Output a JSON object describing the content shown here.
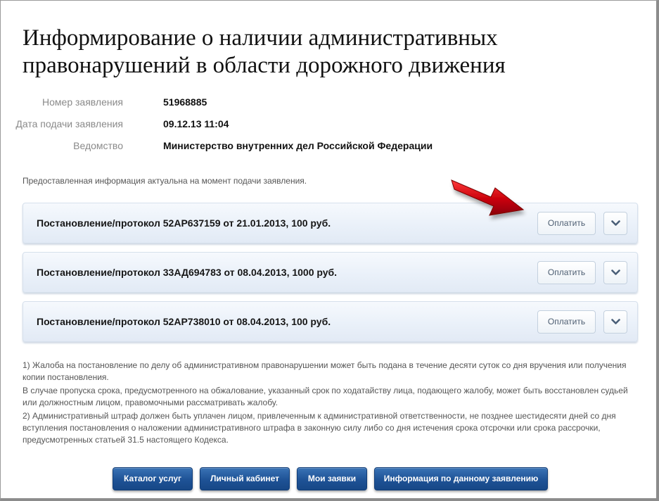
{
  "page": {
    "title": "Информирование о наличии административных правонарушений в области дорожного движения"
  },
  "application": {
    "number_label": "Номер заявления",
    "number_value": "51968885",
    "date_label": "Дата подачи заявления",
    "date_value": "09.12.13 11:04",
    "agency_label": "Ведомство",
    "agency_value": "Министерство внутренних дел Российской Федерации"
  },
  "notice": "Предоставленная информация актуальна на момент подачи заявления.",
  "protocols": [
    {
      "text": "Постановление/протокол 52АР637159 от 21.01.2013, 100 руб.",
      "pay_label": "Оплатить"
    },
    {
      "text": "Постановление/протокол 33АД694783 от 08.04.2013, 1000 руб.",
      "pay_label": "Оплатить"
    },
    {
      "text": "Постановление/протокол 52АР738010 от 08.04.2013, 100 руб.",
      "pay_label": "Оплатить"
    }
  ],
  "footnotes": {
    "note1": "1) Жалоба на постановление по делу об административном правонарушении может быть подана в течение десяти суток со дня вручения или получения копии постановления.",
    "note1b": "В случае пропуска срока, предусмотренного на обжалование, указанный срок по ходатайству лица, подающего жалобу, может быть восстановлен судьей или должностным лицом, правомочными рассматривать жалобу.",
    "note2": "2) Административный штраф должен быть уплачен лицом, привлеченным к административной ответственности, не позднее шестидесяти дней со дня вступления постановления о наложении административного штрафа в законную силу либо со дня истечения срока отсрочки или срока рассрочки, предусмотренных статьей 31.5 настоящего Кодекса."
  },
  "nav": {
    "catalog_label": "Каталог услуг",
    "cabinet_label": "Личный кабинет",
    "my_requests_label": "Мои заявки",
    "info_label": "Информация по данному заявлению"
  },
  "icons": {
    "expand": "chevron-down-icon",
    "annotation": "red-arrow-icon"
  },
  "colors": {
    "nav_button": "#1e5296",
    "protocol_bg": "#e9f0f9",
    "arrow": "#c8000a"
  }
}
